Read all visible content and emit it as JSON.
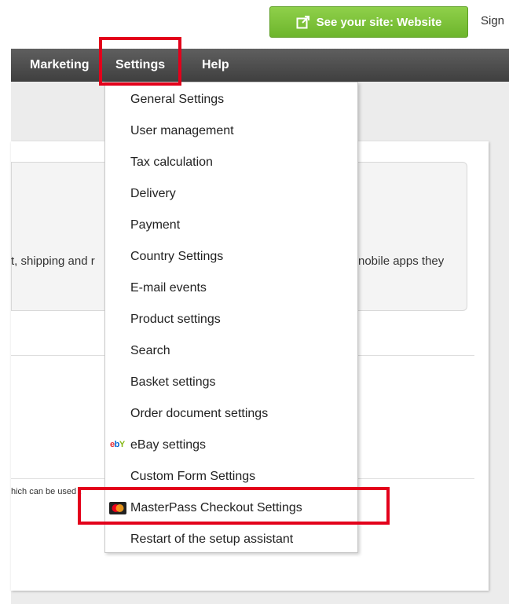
{
  "topbar": {
    "see_site_label": "See your site: Website",
    "signin_label": "Sign"
  },
  "nav": {
    "items": [
      {
        "label": "Marketing"
      },
      {
        "label": "Settings"
      },
      {
        "label": "Help"
      }
    ]
  },
  "content": {
    "info_left": "t, shipping and r",
    "info_right": "nobile apps they",
    "small_text": "hich can be used t"
  },
  "dropdown": {
    "items": [
      {
        "label": "General Settings"
      },
      {
        "label": "User management"
      },
      {
        "label": "Tax calculation"
      },
      {
        "label": "Delivery"
      },
      {
        "label": "Payment"
      },
      {
        "label": "Country Settings"
      },
      {
        "label": "E-mail events"
      },
      {
        "label": "Product settings"
      },
      {
        "label": "Search"
      },
      {
        "label": "Basket settings"
      },
      {
        "label": "Order document settings"
      },
      {
        "label": "eBay settings",
        "icon": "ebay-logo-icon"
      },
      {
        "label": "Custom Form Settings"
      },
      {
        "label": "MasterPass Checkout Settings",
        "icon": "masterpass-logo-icon"
      },
      {
        "label": "Restart of the setup assistant"
      }
    ]
  },
  "colors": {
    "accent_green": "#6db52c",
    "nav_bg": "#4a4a4a",
    "highlight_red": "#e3001b"
  }
}
